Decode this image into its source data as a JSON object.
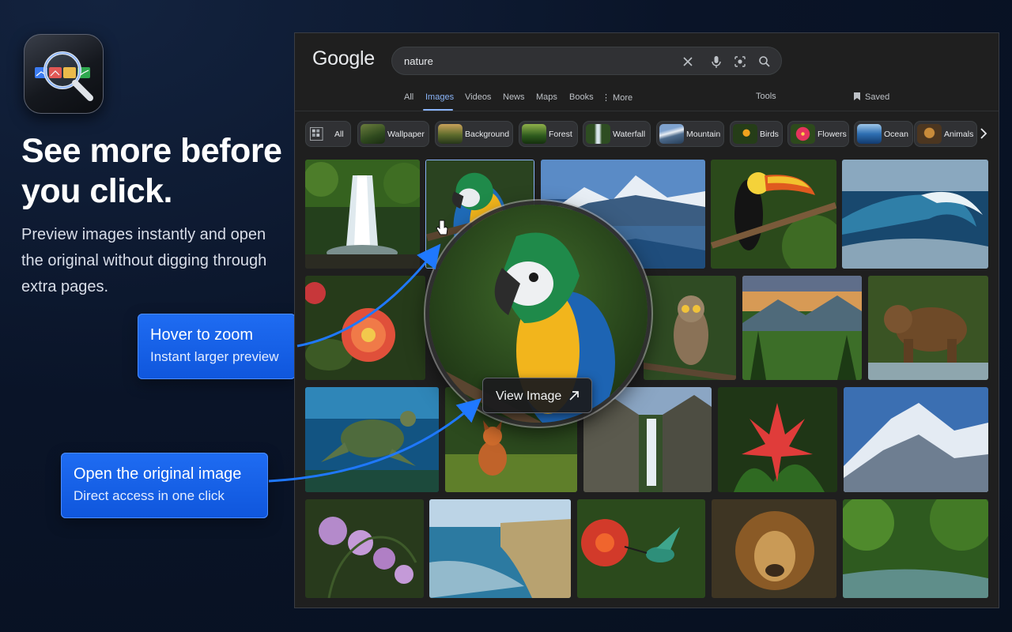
{
  "hero": {
    "headline": "See more before you click.",
    "subcopy": "Preview images instantly and open the original without digging through extra pages."
  },
  "callouts": {
    "zoom": {
      "title": "Hover to zoom",
      "subtitle": "Instant larger preview"
    },
    "open": {
      "title": "Open the original image",
      "subtitle": "Direct access in one click"
    }
  },
  "browser": {
    "logo": "Google",
    "search": {
      "value": "nature"
    },
    "tabs": [
      {
        "label": "All"
      },
      {
        "label": "Images"
      },
      {
        "label": "Videos"
      },
      {
        "label": "News"
      },
      {
        "label": "Maps"
      },
      {
        "label": "Books"
      },
      {
        "label": "⋮ More"
      }
    ],
    "active_tab": "Images",
    "tools_label": "Tools",
    "saved_label": "Saved",
    "chips": [
      {
        "label": "All"
      },
      {
        "label": "Wallpaper"
      },
      {
        "label": "Background"
      },
      {
        "label": "Forest"
      },
      {
        "label": "Waterfall"
      },
      {
        "label": "Mountain"
      },
      {
        "label": "Birds"
      },
      {
        "label": "Flowers"
      },
      {
        "label": "Ocean"
      },
      {
        "label": "Animals"
      }
    ],
    "view_image_label": "View Image"
  },
  "colors": {
    "accent": "#1a66ee",
    "link_active": "#8ab4f8",
    "panel_bg": "#1f1f1f"
  }
}
